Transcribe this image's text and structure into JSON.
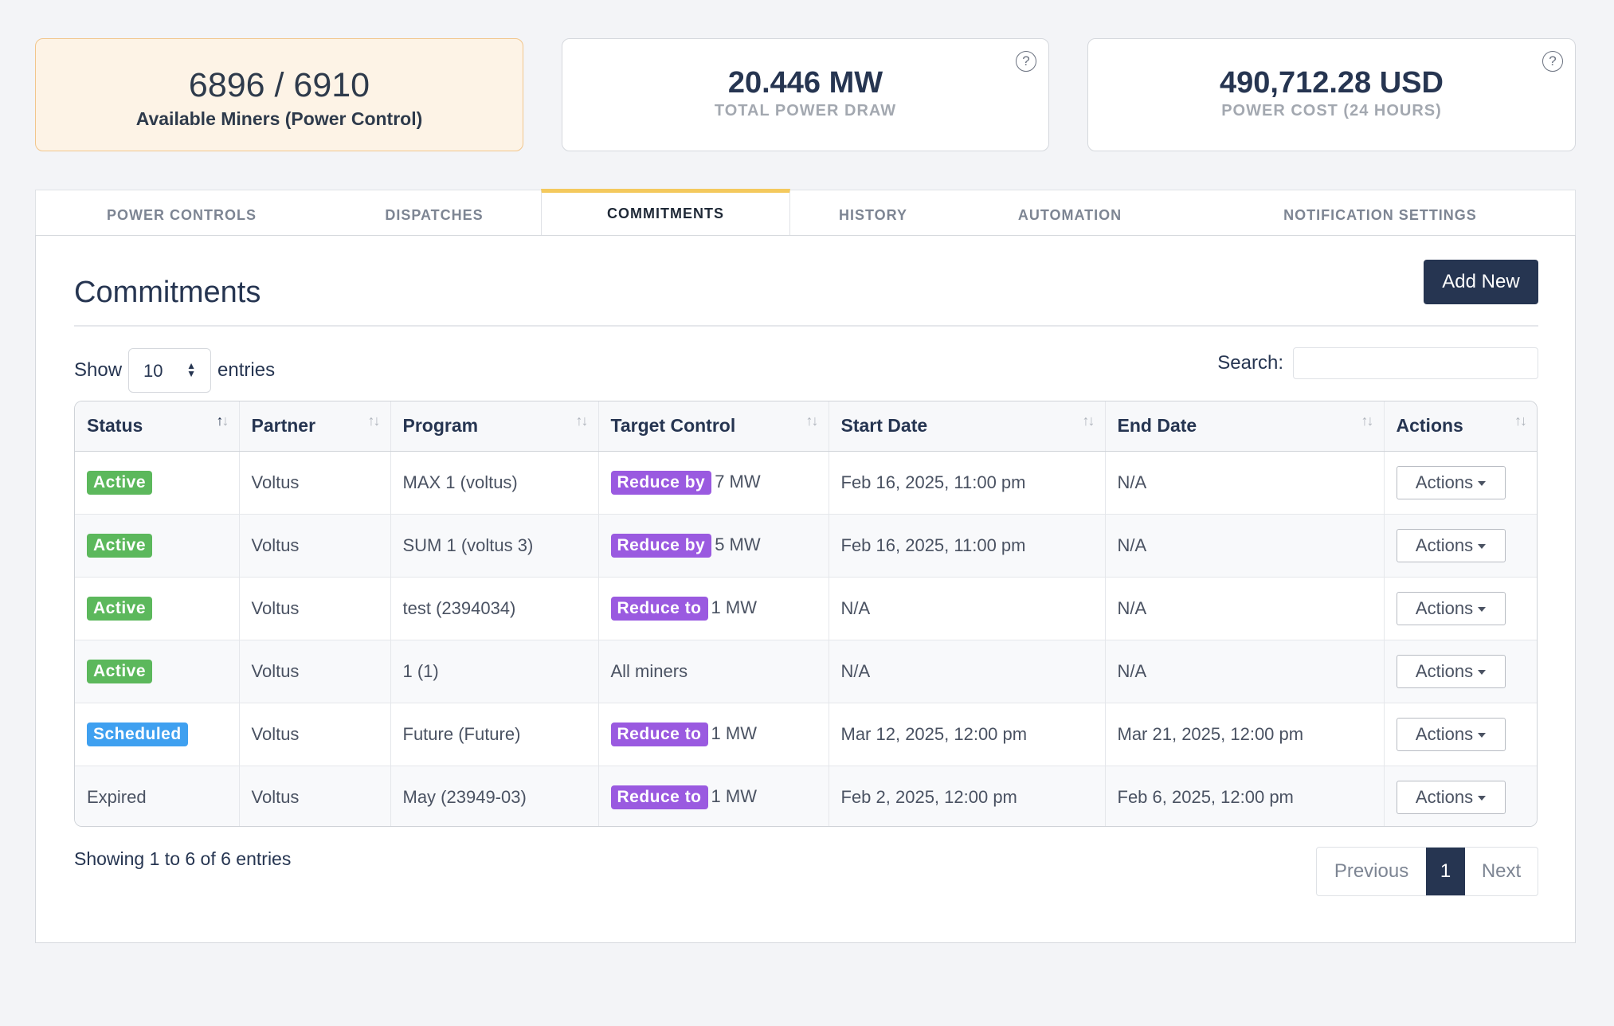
{
  "stats": {
    "miners": {
      "value": "6896 / 6910",
      "label": "Available Miners (Power Control)"
    },
    "power": {
      "value": "20.446 MW",
      "label": "TOTAL POWER DRAW",
      "help": "?"
    },
    "cost": {
      "value": "490,712.28 USD",
      "label": "POWER COST (24 HOURS)",
      "help": "?"
    }
  },
  "tabs": [
    {
      "label": "POWER CONTROLS"
    },
    {
      "label": "DISPATCHES"
    },
    {
      "label": "COMMITMENTS"
    },
    {
      "label": "HISTORY"
    },
    {
      "label": "AUTOMATION"
    },
    {
      "label": "NOTIFICATION SETTINGS"
    }
  ],
  "active_tab": "COMMITMENTS",
  "panel": {
    "title": "Commitments",
    "add_label": "Add New",
    "show_label": "Show",
    "entries_label": "entries",
    "page_length": "10",
    "search_label": "Search:",
    "search_placeholder": ""
  },
  "table": {
    "headers": [
      "Status",
      "Partner",
      "Program",
      "Target Control",
      "Start Date",
      "End Date",
      "Actions"
    ],
    "rows": [
      {
        "status": "Active",
        "status_type": "active",
        "partner": "Voltus",
        "program": "MAX 1 (voltus)",
        "target_badge": "Reduce by",
        "target_value": "7 MW",
        "start": "Feb 16, 2025, 11:00 pm",
        "end": "N/A",
        "action": "Actions"
      },
      {
        "status": "Active",
        "status_type": "active",
        "partner": "Voltus",
        "program": "SUM 1 (voltus 3)",
        "target_badge": "Reduce by",
        "target_value": "5 MW",
        "start": "Feb 16, 2025, 11:00 pm",
        "end": "N/A",
        "action": "Actions"
      },
      {
        "status": "Active",
        "status_type": "active",
        "partner": "Voltus",
        "program": "test (2394034)",
        "target_badge": "Reduce to",
        "target_value": "1 MW",
        "start": "N/A",
        "end": "N/A",
        "action": "Actions"
      },
      {
        "status": "Active",
        "status_type": "active",
        "partner": "Voltus",
        "program": "1 (1)",
        "target_badge": "",
        "target_value": "All miners",
        "start": "N/A",
        "end": "N/A",
        "action": "Actions"
      },
      {
        "status": "Scheduled",
        "status_type": "scheduled",
        "partner": "Voltus",
        "program": "Future (Future)",
        "target_badge": "Reduce to",
        "target_value": "1 MW",
        "start": "Mar 12, 2025, 12:00 pm",
        "end": "Mar 21, 2025, 12:00 pm",
        "action": "Actions"
      },
      {
        "status": "Expired",
        "status_type": "expired",
        "partner": "Voltus",
        "program": "May (23949-03)",
        "target_badge": "Reduce to",
        "target_value": "1 MW",
        "start": "Feb 2, 2025, 12:00 pm",
        "end": "Feb 6, 2025, 12:00 pm",
        "action": "Actions"
      }
    ]
  },
  "footer": {
    "info": "Showing 1 to 6 of 6 entries",
    "previous": "Previous",
    "page": "1",
    "next": "Next"
  },
  "colors": {
    "primary": "#263551",
    "accent_tab": "#f4c95d",
    "active_badge": "#5cb85c",
    "scheduled_badge": "#3fa0f0",
    "reduce_badge": "#9a5ae0"
  }
}
